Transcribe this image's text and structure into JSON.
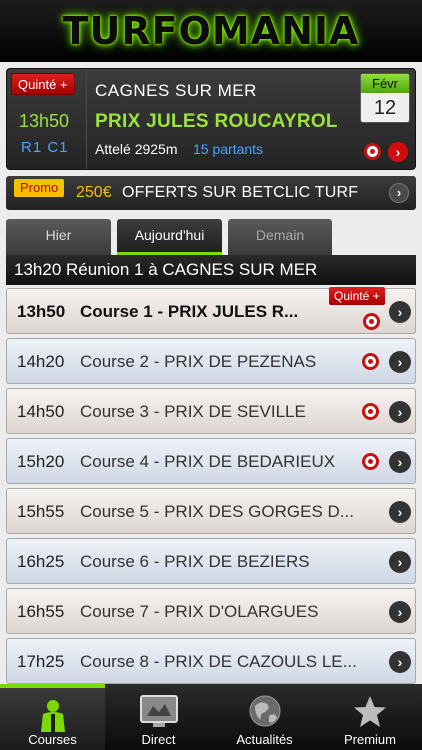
{
  "app": {
    "logo": "TURFOMANIA"
  },
  "featured": {
    "badge": "Quinté +",
    "time": "13h50",
    "reunion": "R1 C1",
    "venue": "CAGNES SUR MER",
    "race_name": "PRIX JULES ROUCAYROL",
    "distance": "Attelé 2925m",
    "partants": "15 partants",
    "calendar": {
      "month": "Févr",
      "day": "12"
    }
  },
  "promo": {
    "badge": "Promo",
    "amount": "250€",
    "text": "OFFERTS SUR BETCLIC TURF"
  },
  "day_tabs": [
    {
      "label": "Hier"
    },
    {
      "label": "Aujourd'hui"
    },
    {
      "label": "Demain"
    }
  ],
  "reunion_header": "13h20 Réunion 1 à CAGNES SUR MER",
  "races": [
    {
      "time": "13h50",
      "label": "Course 1 - PRIX JULES R...",
      "quinte": "Quinté +"
    },
    {
      "time": "14h20",
      "label": "Course 2 - PRIX DE PEZENAS"
    },
    {
      "time": "14h50",
      "label": "Course 3 - PRIX DE SEVILLE"
    },
    {
      "time": "15h20",
      "label": "Course 4 - PRIX DE BEDARIEUX"
    },
    {
      "time": "15h55",
      "label": "Course 5 - PRIX DES GORGES D..."
    },
    {
      "time": "16h25",
      "label": "Course 6 - PRIX DE BEZIERS"
    },
    {
      "time": "16h55",
      "label": "Course 7 - PRIX D'OLARGUES"
    },
    {
      "time": "17h25",
      "label": "Course 8 - PRIX DE CAZOULS LE..."
    }
  ],
  "bottom_tabs": [
    {
      "label": "Courses",
      "icon": "jockey-icon"
    },
    {
      "label": "Direct",
      "icon": "tv-monitor-icon"
    },
    {
      "label": "Actualités",
      "icon": "globe-icon"
    },
    {
      "label": "Premium",
      "icon": "star-icon"
    }
  ],
  "colors": {
    "accent_green": "#7bdb00",
    "link_blue": "#4aa3ff",
    "quinte_red": "#c41212",
    "promo_yellow": "#f2c200"
  }
}
